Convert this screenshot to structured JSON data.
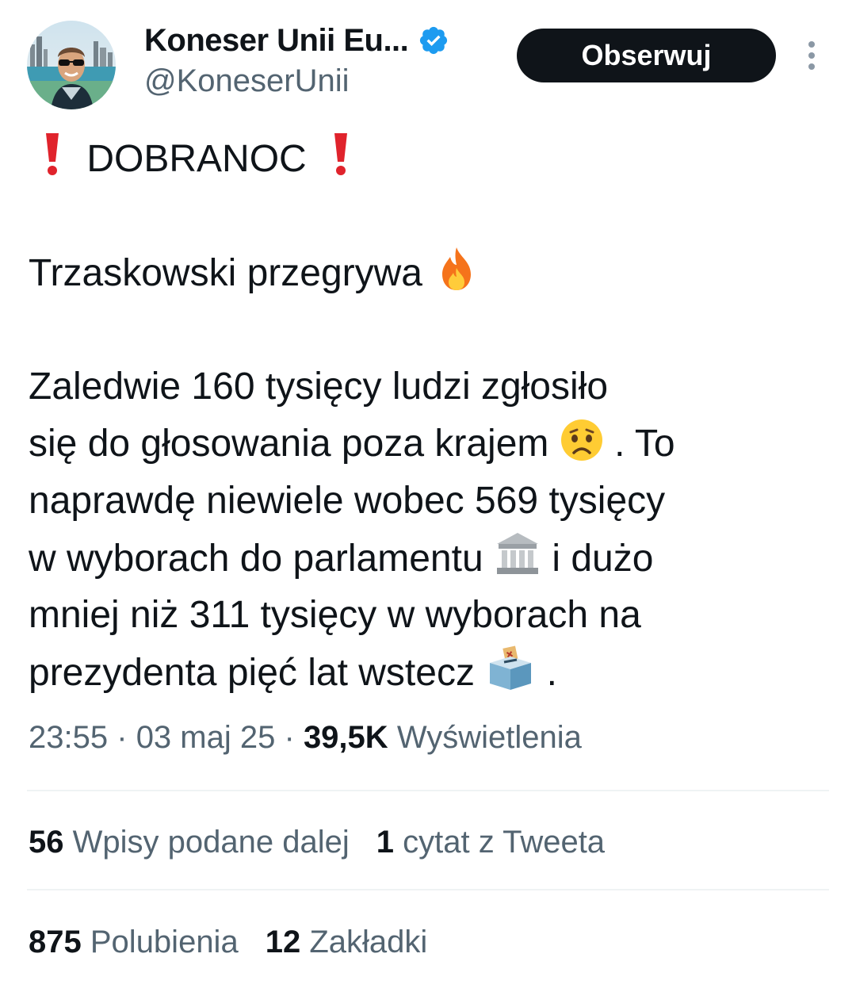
{
  "author": {
    "display_name": "Koneser Unii Eu...",
    "handle": "@KoneserUnii",
    "verified": true
  },
  "actions": {
    "follow_label": "Obserwuj"
  },
  "tweet": {
    "headline_text": "DOBRANOC",
    "line_2": "Trzaskowski przegrywa",
    "line_3": "Zaledwie 160 tysięcy ludzi zgłosiło",
    "line_4_a": "się do głosowania poza krajem",
    "line_4_b": ". To",
    "line_5": "naprawdę niewiele wobec 569 tysięcy",
    "line_6_a": "w wyborach do parlamentu",
    "line_6_b": " i dużo",
    "line_7": "mniej niż 311 tysięcy w wyborach na",
    "line_8_a": "prezydenta pięć lat wstecz",
    "line_8_b": ".",
    "emojis": [
      "exclamation-icon",
      "fire-icon",
      "worried-face-icon",
      "classical-building-icon",
      "ballot-box-icon"
    ]
  },
  "meta": {
    "time": "23:55",
    "separator": "·",
    "date": "03 maj 25",
    "views_count": "39,5K",
    "views_label": "Wyświetlenia"
  },
  "stats": {
    "reposts_count": "56",
    "reposts_label": "Wpisy podane dalej",
    "quotes_count": "1",
    "quotes_label": "cytat z Tweeta",
    "likes_count": "875",
    "likes_label": "Polubienia",
    "bookmarks_count": "12",
    "bookmarks_label": "Zakładki"
  },
  "colors": {
    "text": "#0f1419",
    "secondary": "#536471",
    "verified": "#1d9bf0",
    "divider": "#eff3f4",
    "follow_bg": "#0f1419"
  }
}
